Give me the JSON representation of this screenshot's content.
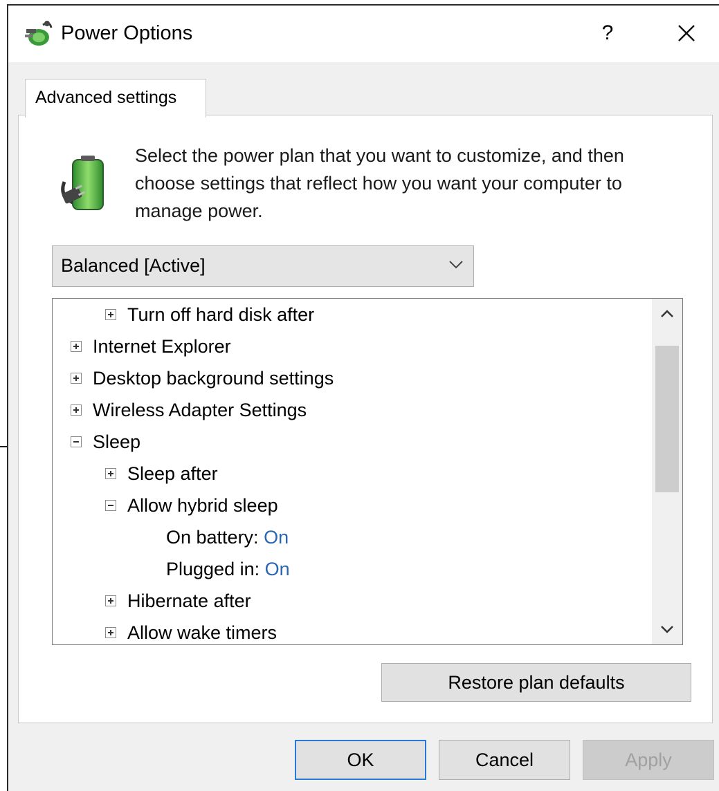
{
  "window": {
    "title": "Power Options",
    "help_label": "?"
  },
  "tabs": [
    {
      "label": "Advanced settings"
    }
  ],
  "intro_text": "Select the power plan that you want to customize, and then choose settings that reflect how you want your computer to manage power.",
  "plan_select": {
    "value": "Balanced [Active]"
  },
  "tree": [
    {
      "label": "Turn off hard disk after",
      "expander": "plus"
    },
    {
      "label": "Internet Explorer",
      "expander": "plus"
    },
    {
      "label": "Desktop background settings",
      "expander": "plus"
    },
    {
      "label": "Wireless Adapter Settings",
      "expander": "plus"
    },
    {
      "label": "Sleep",
      "expander": "minus"
    },
    {
      "label": "Sleep after",
      "expander": "plus"
    },
    {
      "label": "Allow hybrid sleep",
      "expander": "minus"
    },
    {
      "label": "On battery:",
      "value": "On"
    },
    {
      "label": "Plugged in:",
      "value": "On"
    },
    {
      "label": "Hibernate after",
      "expander": "plus"
    },
    {
      "label": "Allow wake timers",
      "expander": "plus"
    }
  ],
  "buttons": {
    "restore": "Restore plan defaults",
    "ok": "OK",
    "cancel": "Cancel",
    "apply": "Apply"
  },
  "colors": {
    "value_link": "#2a66b2",
    "ok_focus": "#2a7ad4"
  }
}
